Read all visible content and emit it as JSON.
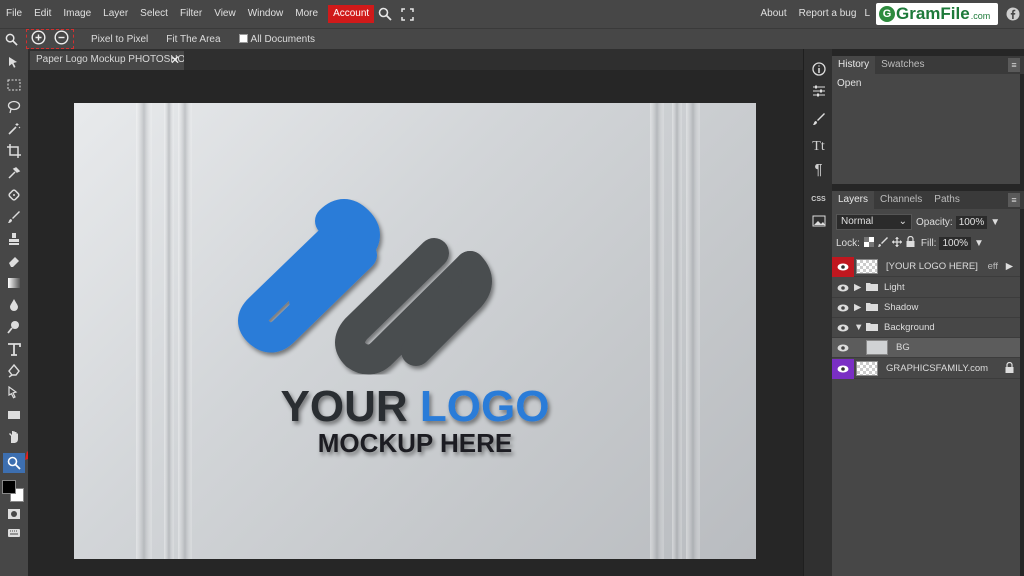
{
  "menu": {
    "items": [
      "File",
      "Edit",
      "Image",
      "Layer",
      "Select",
      "Filter",
      "View",
      "Window",
      "More"
    ],
    "account": "Account",
    "about": "About",
    "report": "Report a bug",
    "letter": "L"
  },
  "watermark": {
    "mark": "G",
    "name": "GramFile",
    "suffix": ".com"
  },
  "options": {
    "pixel_to_pixel": "Pixel to Pixel",
    "fit_area": "Fit The Area",
    "all_documents": "All Documents"
  },
  "document": {
    "tab_title": "Paper Logo Mockup PHOTOSHOP"
  },
  "canvas": {
    "line1a": "YOUR ",
    "line1b": "LOGO",
    "line2": "MOCKUP HERE"
  },
  "history": {
    "tab": "History",
    "tab2": "Swatches",
    "items": [
      "Open"
    ]
  },
  "layers": {
    "tabs": [
      "Layers",
      "Channels",
      "Paths"
    ],
    "blend_mode": "Normal",
    "opacity_label": "Opacity:",
    "opacity": "100%",
    "lock_label": "Lock:",
    "fill_label": "Fill:",
    "fill": "100%",
    "rows": [
      "[YOUR LOGO HERE]",
      "Light",
      "Shadow",
      "Background",
      "BG",
      "GRAPHICSFAMILY.com"
    ],
    "eff": "eff"
  },
  "panel_icons": {
    "tt": "Tt",
    "para": "¶",
    "css": "CSS"
  },
  "colors": {
    "account": "#d01a1a",
    "accent_blue": "#2b7bd8",
    "logo_gray": "#4a4d50",
    "purple": "#7a2fc4",
    "red_eye": "#c0171f"
  }
}
